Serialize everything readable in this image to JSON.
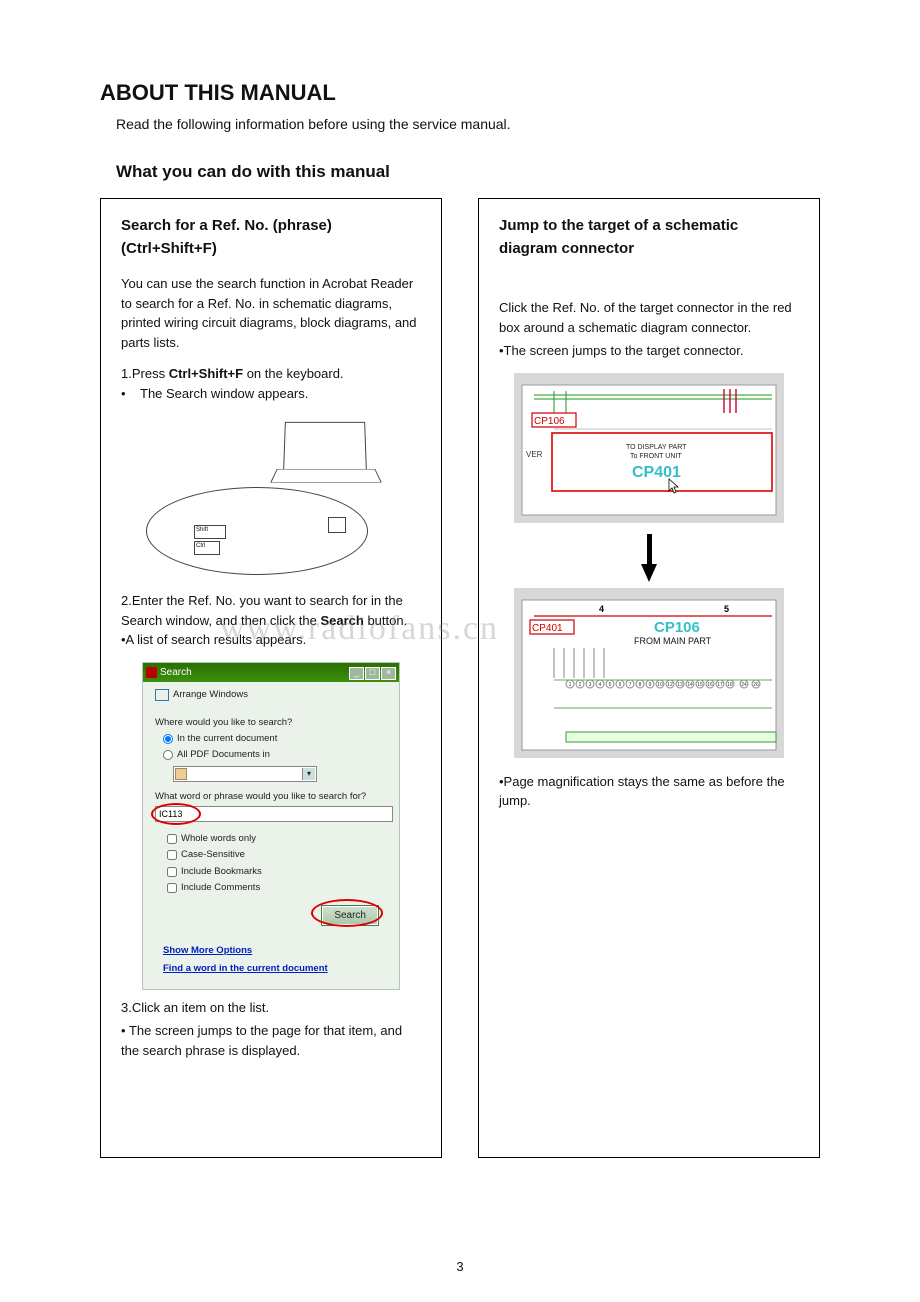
{
  "title": "ABOUT THIS MANUAL",
  "intro": "Read the following information before using the service manual.",
  "section_heading": "What you can do with this manual",
  "watermark": "www.radiofans.cn",
  "page_number": "3",
  "left": {
    "title": "Search for a Ref. No. (phrase) (Ctrl+Shift+F)",
    "desc": "You can use the search function in Acrobat Reader to search for a Ref. No. in schematic diagrams, printed wiring circuit diagrams, block diagrams, and parts lists.",
    "step1_pre": "1.Press ",
    "step1_bold": "Ctrl+Shift+F",
    "step1_post": " on the keyboard.",
    "step1_bullet": "The Search window appears.",
    "key_shift": "Shift",
    "key_ctrl": "Ctrl",
    "step2_pre": "2.Enter the Ref. No. you want to search for in the Search window, and then click the ",
    "step2_bold": "Search",
    "step2_post": " button.",
    "step2_bullet": "•A list of search results appears.",
    "step3": "3.Click an item on the list.",
    "step3_bullet": "• The screen jumps to the page for that item, and the search phrase is displayed."
  },
  "search_dialog": {
    "title": "Search",
    "arrange": "Arrange Windows",
    "q_where": "Where would you like to search?",
    "radio_current": "In the current document",
    "radio_all": "All PDF Documents in",
    "q_word": "What word or phrase would you like to search for?",
    "input_value": "IC113",
    "chk_whole": "Whole words only",
    "chk_case": "Case-Sensitive",
    "chk_bookmarks": "Include Bookmarks",
    "chk_comments": "Include Comments",
    "btn_search": "Search",
    "link_more": "Show More Options",
    "link_find": "Find a word in the current document"
  },
  "right": {
    "title": "Jump to the target of a schematic diagram connector",
    "desc_line1": "Click the Ref. No. of the target connector in the red box around a schematic diagram connector.",
    "desc_line2": "•The screen jumps to the target connector.",
    "schem1_cp106": "CP106",
    "schem1_ver": "VER",
    "schem1_to1": "TO DISPLAY PART",
    "schem1_to2": "To FRONT UNIT",
    "schem1_target": "CP401",
    "schem2_cp401": "CP401",
    "schem2_cp106": "CP106",
    "schem2_from": "FROM MAIN PART",
    "schem2_axis_4": "4",
    "schem2_axis_5": "5",
    "note": "•Page magnification stays the same as before the jump."
  }
}
